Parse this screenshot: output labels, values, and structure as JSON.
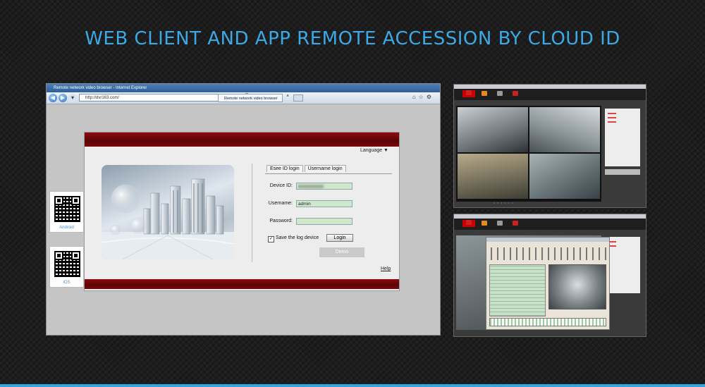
{
  "headline": "WEB CLIENT AND APP REMOTE ACCESSION BY CLOUD ID",
  "browser": {
    "title": "Remote network video browser - Internet Explorer",
    "address": "http://dvr163.com/",
    "tab_label": "Remote network video browser",
    "tab_close": "×"
  },
  "login": {
    "language": "Language ▼",
    "tabs": [
      "Esee ID login",
      "Username login"
    ],
    "device_id_label": "Device ID:",
    "username_label": "Username:",
    "username_value": "admin",
    "password_label": "Password:",
    "save_label": "Save the log device",
    "login_button": "Login",
    "demo_button": "Demo",
    "help": "Help"
  },
  "qr": {
    "android_label": "Android",
    "ios_label": "IOS"
  },
  "colors": {
    "accent": "#3ba9e6",
    "brand_red": "#7a0a0d"
  }
}
